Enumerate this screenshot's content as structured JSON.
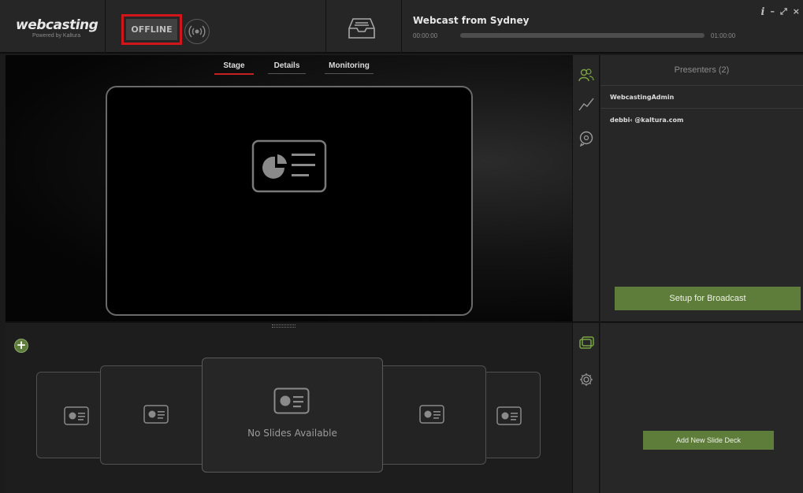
{
  "header": {
    "logo_text": "webcasting",
    "logo_subtext": "Powered by Kaltura",
    "status_label": "OFFLINE",
    "webcast_title": "Webcast from Sydney",
    "time_start": "00:00:00",
    "time_end": "01:00:00",
    "progress_fraction": 0.0,
    "window_controls": {
      "info": "i",
      "minimize": "–",
      "maximize": "⤢",
      "close": "×"
    }
  },
  "stage": {
    "tabs": [
      {
        "label": "Stage",
        "active": true
      },
      {
        "label": "Details",
        "active": false
      },
      {
        "label": "Monitoring",
        "active": false
      }
    ]
  },
  "presenters": {
    "title": "Presenters (2)",
    "list": [
      {
        "name": "WebcastingAdmin"
      },
      {
        "name": "debbi‹          @kaltura.com"
      }
    ],
    "setup_button": "Setup for Broadcast"
  },
  "slides": {
    "empty_text": "No Slides Available",
    "add_deck_button": "Add New Slide Deck"
  },
  "icons": {
    "broadcast": "broadcast-icon",
    "inbox": "inbox-icon",
    "presenters": "users-icon",
    "stats": "chart-line-icon",
    "chat": "chat-icon",
    "slides": "slides-icon",
    "settings": "gear-icon",
    "add": "plus-icon",
    "slide_placeholder": "slide-placeholder-icon"
  },
  "colors": {
    "accent_green": "#5e7d3b",
    "offline_highlight": "#d0161a",
    "active_tab_underline": "#c4211f"
  }
}
